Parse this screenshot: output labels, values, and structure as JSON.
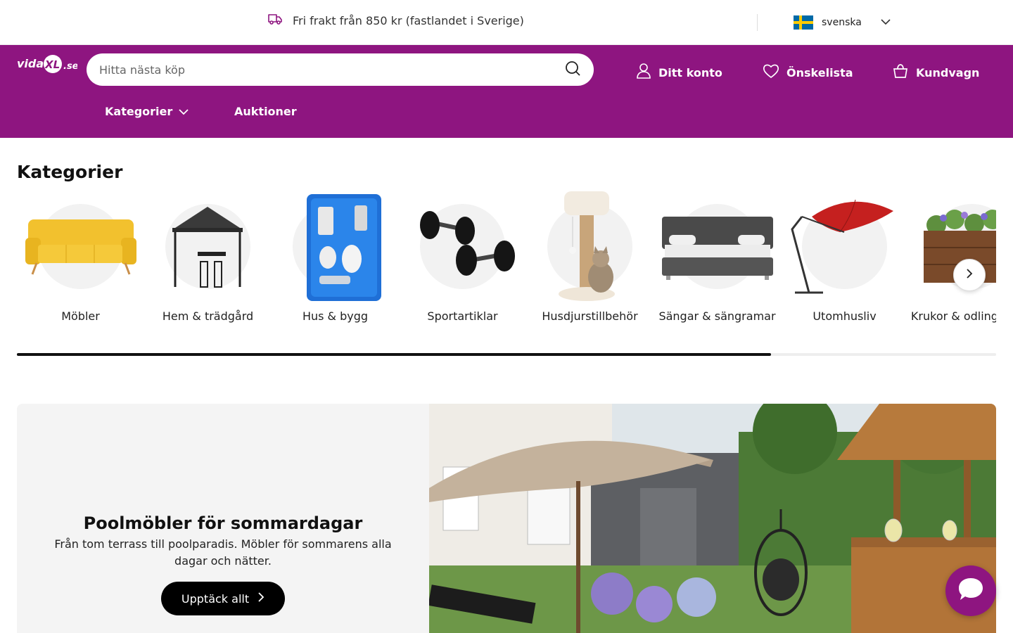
{
  "topbar": {
    "shipping_text": "Fri frakt från 850 kr (fastlandet i Sverige)",
    "language": "svenska"
  },
  "header": {
    "logo_text": "vidaXL.se",
    "search_placeholder": "Hitta nästa köp",
    "account_label": "Ditt konto",
    "wishlist_label": "Önskelista",
    "cart_label": "Kundvagn",
    "nav": {
      "categories_label": "Kategorier",
      "auctions_label": "Auktioner"
    }
  },
  "categories": {
    "title": "Kategorier",
    "scroll_progress": 0.77,
    "items": [
      {
        "label": "Möbler"
      },
      {
        "label": "Hem & trädgård"
      },
      {
        "label": "Hus & bygg"
      },
      {
        "label": "Sportartiklar"
      },
      {
        "label": "Husdjurstillbehör"
      },
      {
        "label": "Sängar & sängramar"
      },
      {
        "label": "Utomhusliv"
      },
      {
        "label": "Krukor & odlingslådor"
      }
    ]
  },
  "promo": {
    "title": "Poolmöbler för sommardagar",
    "text": "Från tom terrass till poolparadis. Möbler för sommarens alla dagar och nätter.",
    "cta_label": "Upptäck allt"
  },
  "colors": {
    "brand": "#8e1580",
    "cta": "#000000"
  },
  "icons": {
    "shipping": "truck-icon",
    "search": "search-icon",
    "account": "user-icon",
    "wishlist": "heart-icon",
    "cart": "basket-icon",
    "next": "chevron-right-icon",
    "chat": "chat-bubble-icon"
  }
}
